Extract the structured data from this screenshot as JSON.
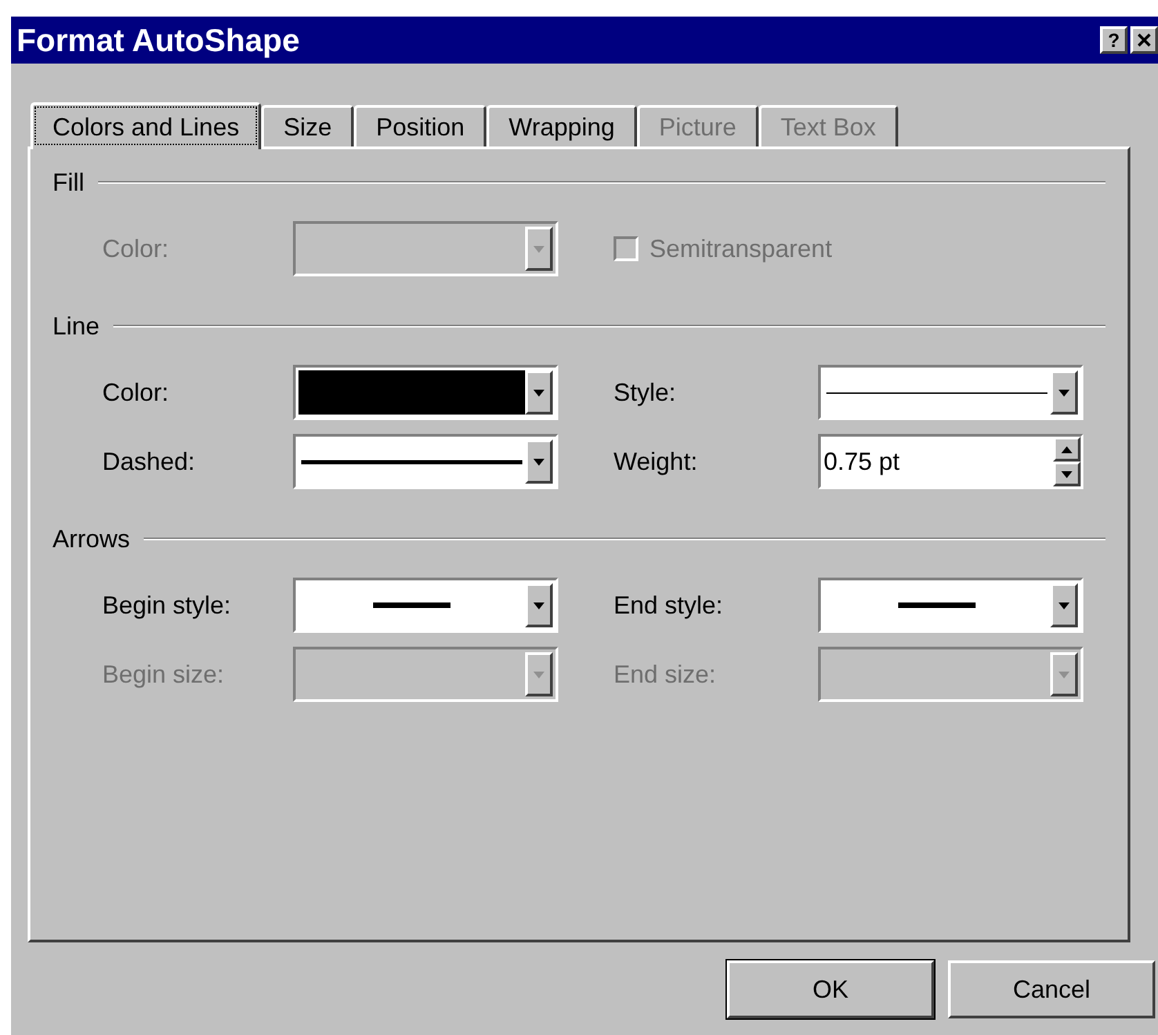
{
  "window": {
    "title": "Format AutoShape",
    "help": "?"
  },
  "tabs": [
    {
      "label": "Colors and Lines",
      "selected": true,
      "disabled": false
    },
    {
      "label": "Size",
      "selected": false,
      "disabled": false
    },
    {
      "label": "Position",
      "selected": false,
      "disabled": false
    },
    {
      "label": "Wrapping",
      "selected": false,
      "disabled": false
    },
    {
      "label": "Picture",
      "selected": false,
      "disabled": true
    },
    {
      "label": "Text Box",
      "selected": false,
      "disabled": true
    }
  ],
  "sections": [
    {
      "title": "Fill",
      "rows": [
        [
          {
            "label": "Color:",
            "disabled": true,
            "kind": "combo"
          },
          {
            "label": "Semitransparent",
            "disabled": true,
            "kind": "checkbox",
            "checked": false
          }
        ]
      ]
    },
    {
      "title": "Line",
      "rows": [
        [
          {
            "label": "Color:",
            "disabled": false,
            "kind": "combo",
            "preview": {
              "kind": "swatch",
              "color": "#000000"
            }
          },
          {
            "label": "Style:",
            "disabled": false,
            "kind": "combo",
            "preview": {
              "kind": "thin-line"
            }
          }
        ],
        [
          {
            "label": "Dashed:",
            "disabled": false,
            "kind": "combo",
            "preview": {
              "kind": "thick-line"
            }
          },
          {
            "label": "Weight:",
            "disabled": false,
            "kind": "spin",
            "value": "0.75 pt"
          }
        ]
      ]
    },
    {
      "title": "Arrows",
      "rows": [
        [
          {
            "label": "Begin style:",
            "disabled": false,
            "kind": "combo",
            "preview": {
              "kind": "short-line"
            }
          },
          {
            "label": "End style:",
            "disabled": false,
            "kind": "combo",
            "preview": {
              "kind": "short-line"
            }
          }
        ],
        [
          {
            "label": "Begin size:",
            "disabled": true,
            "kind": "combo"
          },
          {
            "label": "End size:",
            "disabled": true,
            "kind": "combo"
          }
        ]
      ]
    }
  ],
  "buttons": [
    "OK",
    "Cancel"
  ]
}
